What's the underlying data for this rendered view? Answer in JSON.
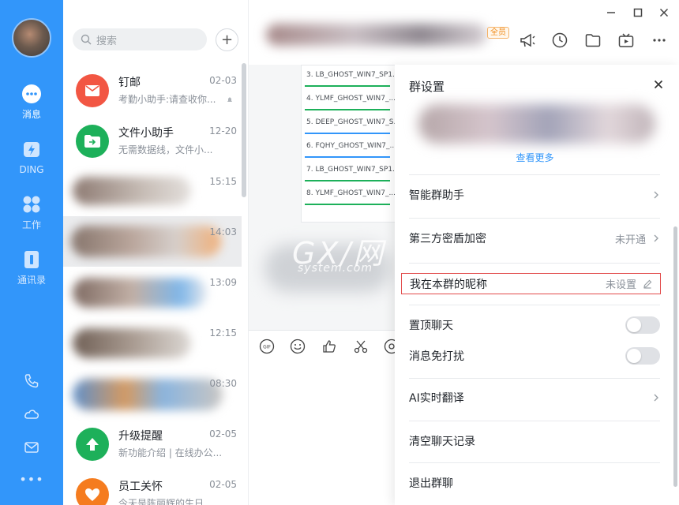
{
  "colors": {
    "accent": "#3296fa",
    "highlight": "#e24b4b"
  },
  "rail": {
    "items": [
      {
        "label": "消息",
        "icon": "message-icon"
      },
      {
        "label": "DING",
        "icon": "ding-icon"
      },
      {
        "label": "工作",
        "icon": "work-icon"
      },
      {
        "label": "通讯录",
        "icon": "contacts-icon"
      }
    ],
    "bottom_icons": [
      "phone-icon",
      "cloud-icon",
      "mail-icon",
      "more-icon"
    ],
    "more_label": "•••"
  },
  "list": {
    "search_placeholder": "搜索",
    "add_label": "+",
    "conversations": [
      {
        "name": "钉邮",
        "preview": "考勤小助手:请查收你...",
        "time": "02-03",
        "color": "#f25643"
      },
      {
        "name": "文件小助手",
        "preview": "无需数据线，文件小...",
        "time": "12-20",
        "color": "#1db05a"
      },
      {
        "name": "",
        "preview": "",
        "time": "15:15"
      },
      {
        "name": "",
        "preview": "",
        "time": "14:03"
      },
      {
        "name": "",
        "preview": "",
        "time": "13:09"
      },
      {
        "name": "",
        "preview": "",
        "time": "12:15"
      },
      {
        "name": "",
        "preview": "",
        "time": "08:30"
      },
      {
        "name": "升级提醒",
        "preview": "新功能介绍 | 在线办公...",
        "time": "02-05",
        "color": "#1db05a"
      },
      {
        "name": "员工关怀",
        "preview": "今天是陈丽辉的生日...",
        "time": "02-05",
        "color": "#f57c1f"
      }
    ]
  },
  "chat": {
    "all_tag": "全员",
    "files": [
      "3. LB_GHOST_WIN7_SP1...",
      "4. YLMF_GHOST_WIN7_...",
      "5. DEEP_GHOST_WIN7_S...",
      "6. FQHY_GHOST_WIN7_...",
      "7. LB_GHOST_WIN7_SP1...",
      "8. YLMF_GHOST_WIN7_..."
    ],
    "watermark": "GX/网",
    "watermark_sub": "system.com"
  },
  "drawer": {
    "title": "群设置",
    "see_more": "查看更多",
    "rows": {
      "assistant": "智能群助手",
      "encrypt": "第三方密盾加密",
      "encrypt_value": "未开通",
      "nickname": "我在本群的昵称",
      "nickname_value": "未设置",
      "pin": "置顶聊天",
      "mute": "消息免打扰",
      "translate": "AI实时翻译",
      "clear": "清空聊天记录",
      "exit": "退出群聊"
    }
  }
}
